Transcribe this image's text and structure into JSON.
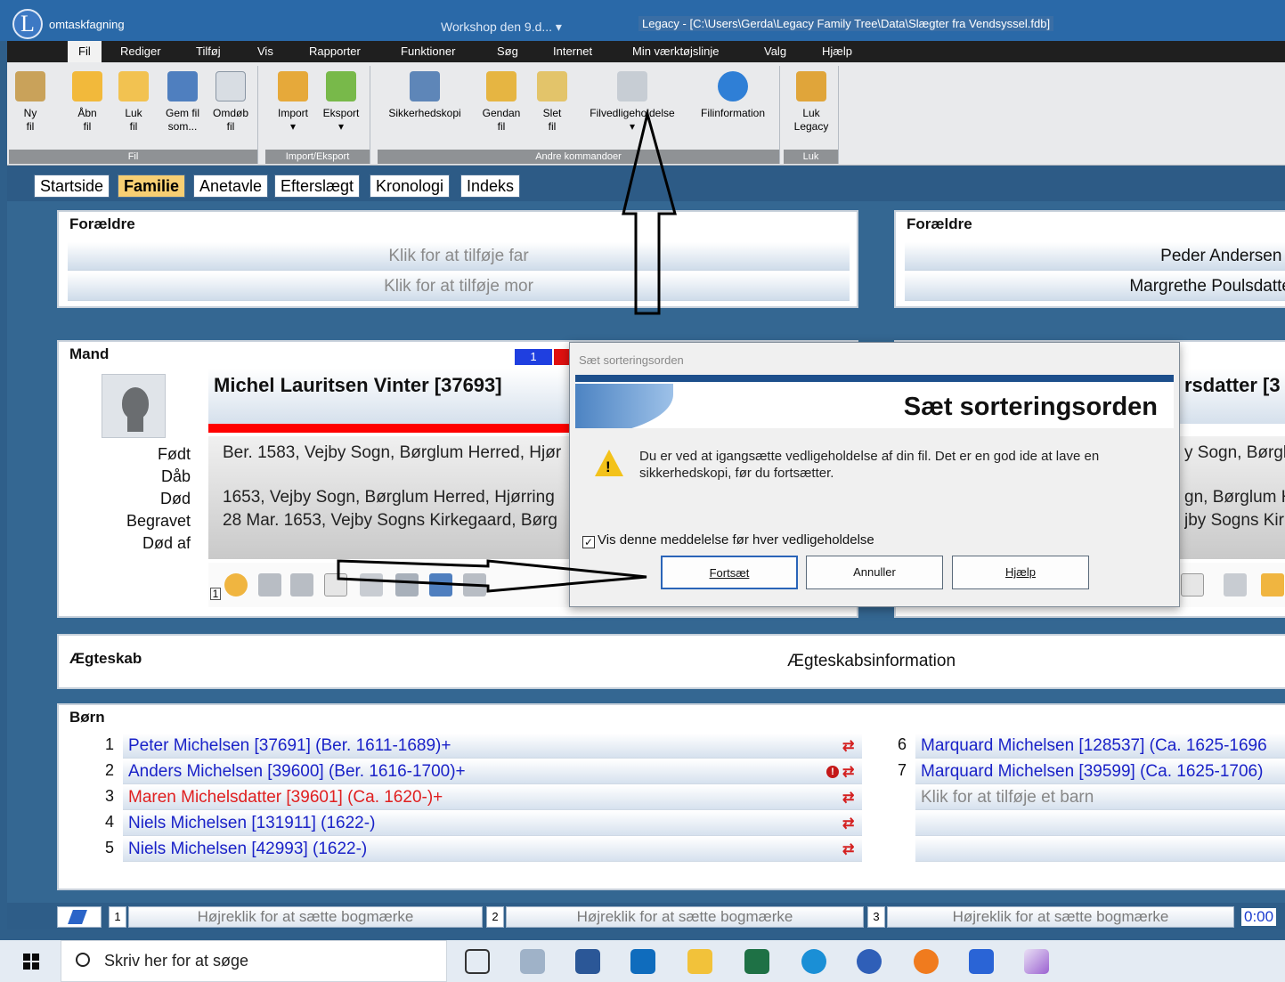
{
  "titlebar": {
    "logo": "L",
    "qat_text": "omtaskfagning",
    "workspace": "Workshop den 9.d...  ▾",
    "title": "Legacy - [C:\\Users\\Gerda\\Legacy Family Tree\\Data\\Slægter fra Vendsyssel.fdb]"
  },
  "menu": [
    "Fil",
    "Rediger",
    "Tilføj",
    "Vis",
    "Rapporter",
    "Funktioner",
    "Søg",
    "Internet",
    "Min værktøjslinje",
    "Valg",
    "Hjælp"
  ],
  "ribbon": {
    "groups": [
      "Fil",
      "Import/Eksport",
      "Andre kommandoer",
      "Luk"
    ],
    "buttons": [
      {
        "l1": "Ny",
        "l2": "fil"
      },
      {
        "l1": "Åbn",
        "l2": "fil"
      },
      {
        "l1": "Luk",
        "l2": "fil"
      },
      {
        "l1": "Gem fil",
        "l2": "som..."
      },
      {
        "l1": "Omdøb",
        "l2": "fil"
      },
      {
        "l1": "Import",
        "l2": "▾"
      },
      {
        "l1": "Eksport",
        "l2": "▾"
      },
      {
        "l1": "Sikkerhedskopi",
        "l2": ""
      },
      {
        "l1": "Gendan",
        "l2": "fil"
      },
      {
        "l1": "Slet",
        "l2": "fil"
      },
      {
        "l1": "Filvedligeholdelse",
        "l2": "▾"
      },
      {
        "l1": "Filinformation",
        "l2": ""
      },
      {
        "l1": "Luk",
        "l2": "Legacy"
      }
    ]
  },
  "tabs": [
    "Startside",
    "Familie",
    "Anetavle",
    "Efterslægt",
    "Kronologi",
    "Indeks"
  ],
  "parents_left": {
    "title": "Forældre",
    "father": "Klik for at tilføje far",
    "mother": "Klik for at tilføje mor"
  },
  "parents_right": {
    "title": "Forældre",
    "father": "Peder Andersen [",
    "mother": "Margrethe Poulsdatte"
  },
  "husband": {
    "title": "Mand",
    "badge1": "1",
    "name": "Michel Lauritsen Vinter [37693]",
    "labels": [
      "Født",
      "Dåb",
      "Død",
      "Begravet",
      "Død af"
    ],
    "born": "Ber. 1583, Vejby Sogn, Børglum Herred, Hjør",
    "died": "1653, Vejby Sogn, Børglum Herred, Hjørring",
    "buried": "28 Mar. 1653, Vejby Sogns Kirkegaard, Børg",
    "strip_number": "1"
  },
  "wife": {
    "name": "rsdatter [3",
    "born": "y Sogn, Børgl",
    "died": "gn, Børglum H",
    "buried": "jby Sogns Kir"
  },
  "marriage": {
    "title": "Ægteskab",
    "info": "Ægteskabsinformation"
  },
  "children": {
    "title": "Børn",
    "left": [
      {
        "n": "1",
        "text": "Peter Michelsen [37691] (Ber. 1611-1689)+"
      },
      {
        "n": "2",
        "text": "Anders Michelsen [39600] (Ber. 1616-1700)+"
      },
      {
        "n": "3",
        "text": "Maren Michelsdatter [39601] (Ca. 1620-)+"
      },
      {
        "n": "4",
        "text": "Niels Michelsen [131911] (1622-)"
      },
      {
        "n": "5",
        "text": "Niels Michelsen [42993] (1622-)"
      }
    ],
    "right": [
      {
        "n": "6",
        "text": "Marquard Michelsen [128537] (Ca. 1625-1696"
      },
      {
        "n": "7",
        "text": "Marquard Michelsen [39599] (Ca. 1625-1706)"
      },
      {
        "n": "",
        "text": "Klik for at tilføje et barn"
      },
      {
        "n": "",
        "text": ""
      }
    ],
    "swap_glyph": "⇄",
    "alert_glyph": "!"
  },
  "bookmarks": [
    {
      "num": "1",
      "text": "Højreklik for at sætte bogmærke"
    },
    {
      "num": "2",
      "text": "Højreklik for at sætte bogmærke"
    },
    {
      "num": "3",
      "text": "Højreklik for at sætte bogmærke"
    }
  ],
  "clock": "0:00",
  "dialog": {
    "title": "Sæt sorteringsorden",
    "heading": "Sæt sorteringsorden",
    "warn": "!",
    "message": "Du er ved at igangsætte vedligeholdelse af din fil.  Det er en god ide at lave en sikkerhedskopi, før du fortsætter.",
    "checkbox_label": "Vis denne meddelelse før hver vedligeholdelse",
    "checkbox_mark": "✓",
    "buttons": [
      "Fortsæt",
      "Annuller",
      "Hjælp"
    ]
  },
  "taskbar": {
    "search_placeholder": "Skriv her for at søge"
  },
  "colors": {
    "accent": "#2a69a8",
    "tab_active": "#f7cf73",
    "link": "#1a22c8",
    "alert": "#e02020"
  }
}
